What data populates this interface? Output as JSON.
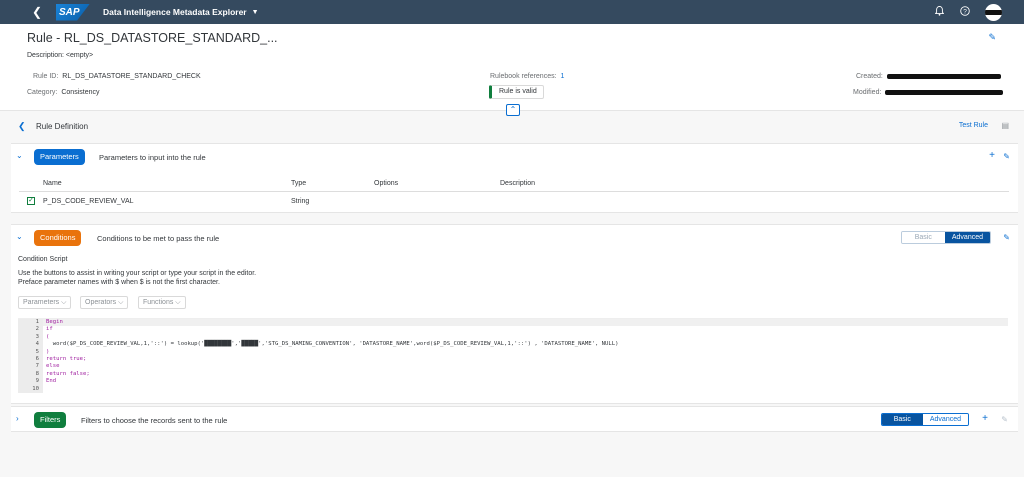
{
  "shell": {
    "app_title": "Data Intelligence Metadata Explorer",
    "logo_text": "SAP"
  },
  "header": {
    "title": "Rule - RL_DS_DATASTORE_STANDARD_...",
    "description": "Description: <empty>",
    "rule_id_label": "Rule ID:",
    "rule_id": "RL_DS_DATASTORE_STANDARD_CHECK",
    "category_label": "Category:",
    "category": "Consistency",
    "rulebook_label": "Rulebook references:",
    "rulebook_count": "1",
    "valid_status": "Rule is valid",
    "created_label": "Created:",
    "modified_label": "Modified:"
  },
  "rule_definition": {
    "title": "Rule Definition",
    "test_rule": "Test Rule"
  },
  "parameters": {
    "tag": "Parameters",
    "subtitle": "Parameters to input into the rule",
    "columns": [
      "Name",
      "Type",
      "Options",
      "Description"
    ],
    "rows": [
      {
        "name": "P_DS_CODE_REVIEW_VAL",
        "type": "String",
        "options": "",
        "description": ""
      }
    ]
  },
  "conditions": {
    "tag": "Conditions",
    "subtitle": "Conditions to be met to pass the rule",
    "mode_basic": "Basic",
    "mode_advanced": "Advanced",
    "script_title": "Condition Script",
    "help_line1": "Use the buttons to assist in writing your script or type your script in the editor.",
    "help_line2": "Preface parameter names with $ when $ is not the first character.",
    "dropdowns": [
      "Parameters",
      "Operators",
      "Functions"
    ],
    "code": [
      {
        "n": "1",
        "text": "Begin"
      },
      {
        "n": "2",
        "text": "if"
      },
      {
        "n": "3",
        "text": "("
      },
      {
        "n": "4",
        "text": "  word($P_DS_CODE_REVIEW_VAL,1,'::') = lookup('████████','█████','STG_DS_NAMING_CONVENTION', 'DATASTORE_NAME',word($P_DS_CODE_REVIEW_VAL,1,'::') , 'DATASTORE_NAME', NULL)"
      },
      {
        "n": "5",
        "text": ")"
      },
      {
        "n": "6",
        "text": "return true;"
      },
      {
        "n": "7",
        "text": "else"
      },
      {
        "n": "8",
        "text": "return false;"
      },
      {
        "n": "9",
        "text": "End"
      },
      {
        "n": "10",
        "text": ""
      }
    ]
  },
  "filters": {
    "tag": "Filters",
    "subtitle": "Filters to choose the records sent to the rule",
    "mode_basic": "Basic",
    "mode_advanced": "Advanced"
  },
  "colors": {
    "shell": "#354a5f",
    "parameters_tag": "#0a6ed1",
    "conditions_tag": "#e9730c",
    "filters_tag": "#107e3e",
    "accent": "#0a6ed1"
  }
}
